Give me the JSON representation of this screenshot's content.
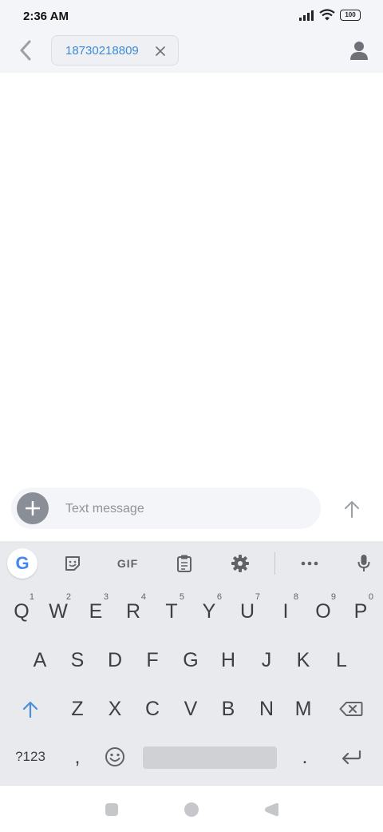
{
  "status": {
    "time": "2:36 AM",
    "battery": "100"
  },
  "header": {
    "recipient": "18730218809"
  },
  "compose": {
    "placeholder": "Text message"
  },
  "keyboard": {
    "toolbar": {
      "gif_label": "GIF",
      "google_label": "G"
    },
    "row1": [
      {
        "key": "Q",
        "hint": "1"
      },
      {
        "key": "W",
        "hint": "2"
      },
      {
        "key": "E",
        "hint": "3"
      },
      {
        "key": "R",
        "hint": "4"
      },
      {
        "key": "T",
        "hint": "5"
      },
      {
        "key": "Y",
        "hint": "6"
      },
      {
        "key": "U",
        "hint": "7"
      },
      {
        "key": "I",
        "hint": "8"
      },
      {
        "key": "O",
        "hint": "9"
      },
      {
        "key": "P",
        "hint": "0"
      }
    ],
    "row2": [
      "A",
      "S",
      "D",
      "F",
      "G",
      "H",
      "J",
      "K",
      "L"
    ],
    "row3": [
      "Z",
      "X",
      "C",
      "V",
      "B",
      "N",
      "M"
    ],
    "row4": {
      "symbols": "?123",
      "comma": ",",
      "period": "."
    }
  },
  "colors": {
    "accent": "#3f8ad2",
    "shift": "#4a90d9",
    "header_bg": "#f4f5f9",
    "keyboard_bg": "#e8eaed"
  }
}
